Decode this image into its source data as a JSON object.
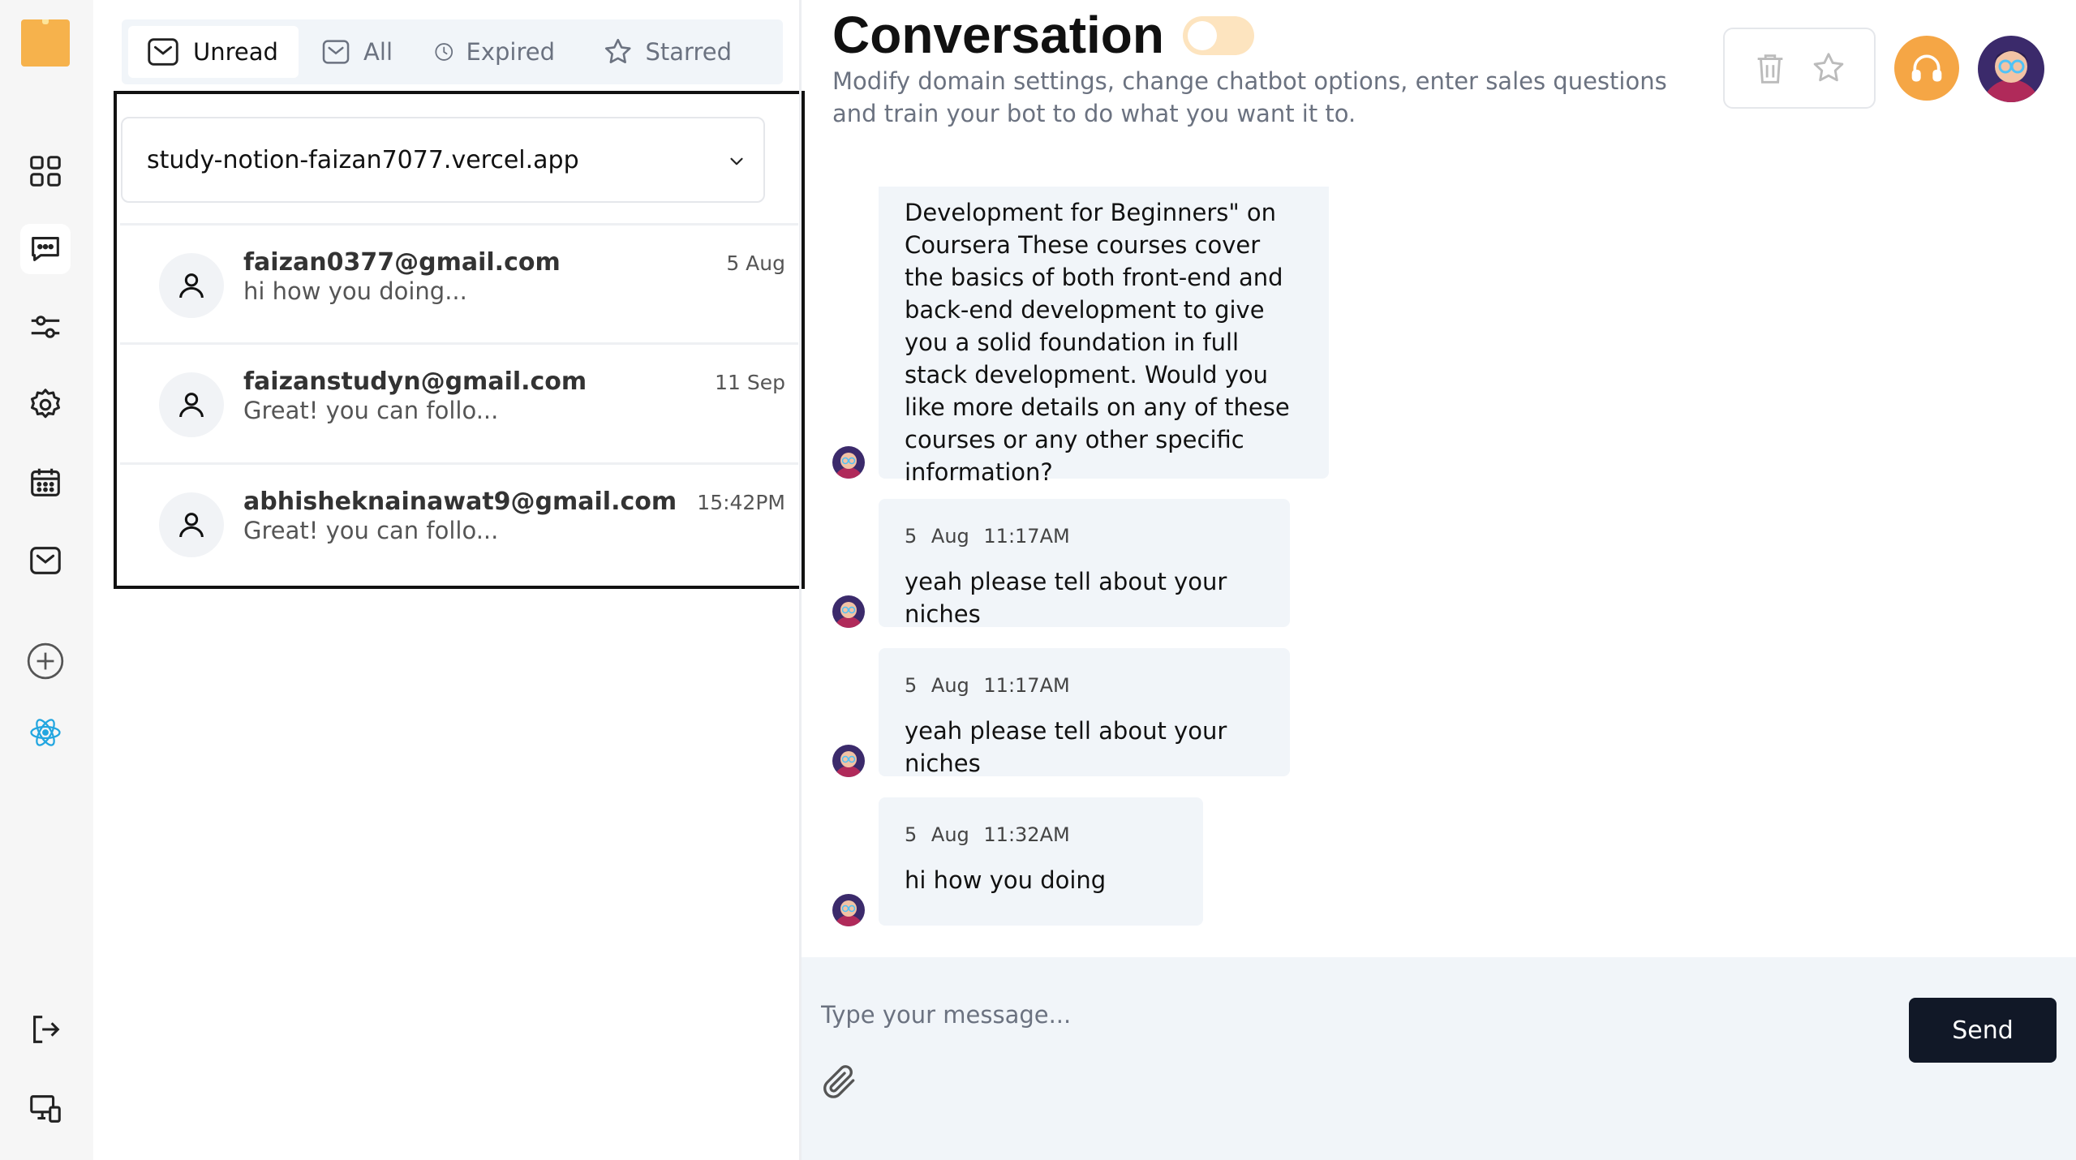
{
  "tabs": [
    {
      "label": "Unread",
      "icon": "mail-icon"
    },
    {
      "label": "All",
      "icon": "mail-icon"
    },
    {
      "label": "Expired",
      "icon": "clock-icon"
    },
    {
      "label": "Starred",
      "icon": "star-icon"
    }
  ],
  "domain_select": {
    "value": "study-notion-faizan7077.vercel.app"
  },
  "conversations": [
    {
      "email": "faizan0377@gmail.com",
      "snippet": "hi how you doing...",
      "time": "5 Aug"
    },
    {
      "email": "faizanstudyn@gmail.com",
      "snippet": "Great! you can follo...",
      "time": "11 Sep"
    },
    {
      "email": "abhisheknainawat9@gmail.com",
      "snippet": "Great! you can follo...",
      "time": "15:42PM"
    }
  ],
  "header": {
    "title": "Conversation",
    "subtitle": "Modify domain settings, change chatbot options, enter sales questions and train your bot to do what you want it to."
  },
  "messages": [
    {
      "date": "",
      "time": "",
      "text": "Development for Beginners\" on Coursera These courses cover the basics of both front-end and back-end development to give you a solid foundation in full stack development. Would you like more details on any of these courses or any other specific information?"
    },
    {
      "date": "5 Aug",
      "time": "11:17AM",
      "text": "yeah please tell about your niches"
    },
    {
      "date": "5 Aug",
      "time": "11:17AM",
      "text": "yeah please tell about your niches"
    },
    {
      "date": "5 Aug",
      "time": "11:32AM",
      "text": "hi how you doing"
    }
  ],
  "composer": {
    "placeholder": "Type your message...",
    "send_label": "Send"
  },
  "colors": {
    "accent": "#f5a645",
    "send_bg": "#111827",
    "bubble_bg": "#f1f5f9",
    "rail_active_icon": "#22a6e0"
  }
}
